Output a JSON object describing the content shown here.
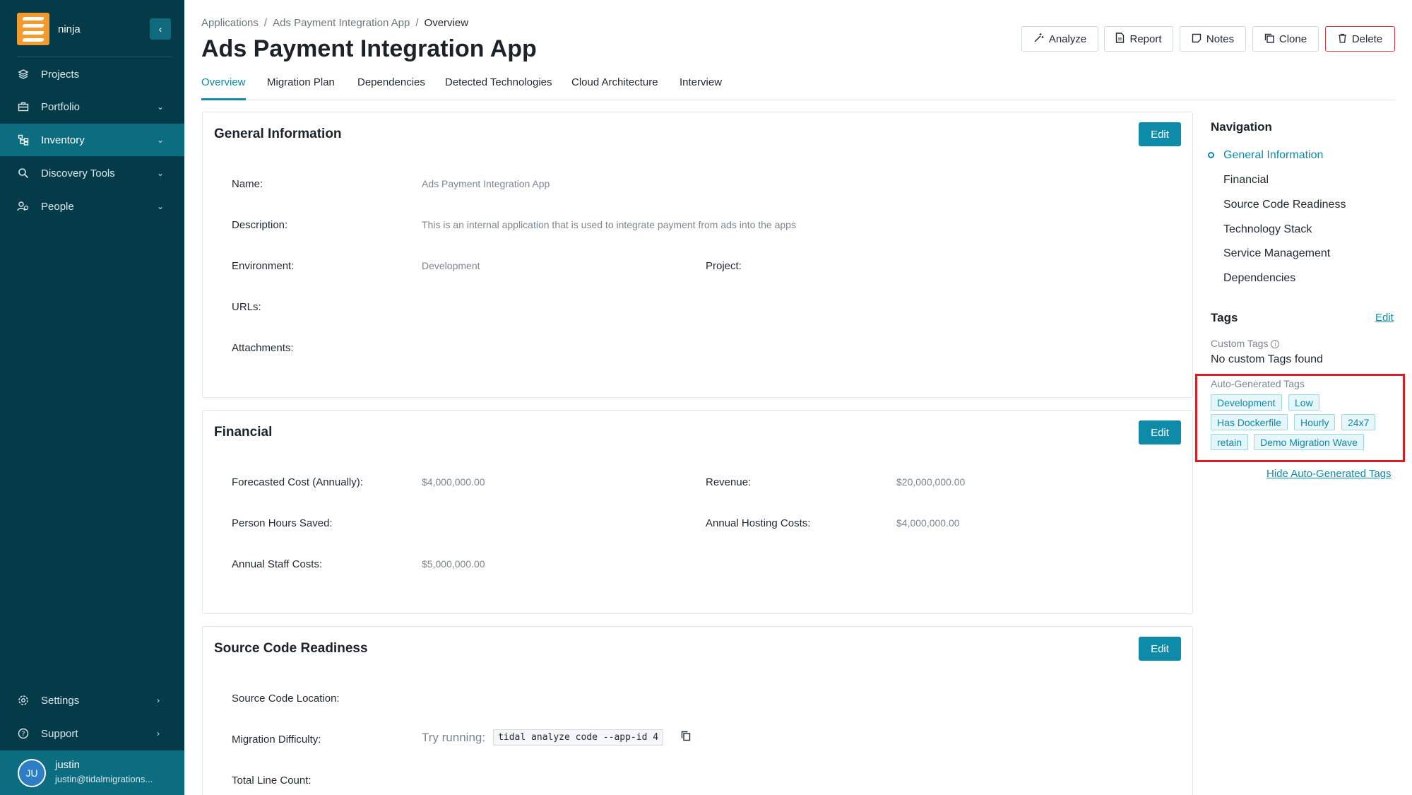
{
  "sidebar": {
    "org": "ninja",
    "items": [
      {
        "label": "Projects",
        "icon": "layers-icon"
      },
      {
        "label": "Portfolio",
        "icon": "briefcase-icon"
      },
      {
        "label": "Inventory",
        "icon": "hierarchy-icon"
      },
      {
        "label": "Discovery Tools",
        "icon": "search-icon"
      },
      {
        "label": "People",
        "icon": "people-icon"
      }
    ],
    "bottom": [
      {
        "label": "Settings",
        "icon": "gear-icon"
      },
      {
        "label": "Support",
        "icon": "help-icon"
      }
    ],
    "user": {
      "initials": "JU",
      "name": "justin",
      "email": "justin@tidalmigrations..."
    }
  },
  "breadcrumb": [
    "Applications",
    "Ads Payment Integration App",
    "Overview"
  ],
  "title": "Ads Payment Integration App",
  "actions": {
    "analyze": "Analyze",
    "report": "Report",
    "notes": "Notes",
    "clone": "Clone",
    "delete": "Delete"
  },
  "tabs": [
    "Overview",
    "Migration Plan",
    "Dependencies",
    "Detected Technologies",
    "Cloud Architecture",
    "Interview"
  ],
  "general": {
    "title": "General Information",
    "edit": "Edit",
    "name_label": "Name:",
    "name": "Ads Payment Integration App",
    "description_label": "Description:",
    "description": "This is an internal application that is used to integrate payment from ads into the apps",
    "environment_label": "Environment:",
    "environment": "Development",
    "project_label": "Project:",
    "urls_label": "URLs:",
    "attachments_label": "Attachments:"
  },
  "financial": {
    "title": "Financial",
    "edit": "Edit",
    "forecasted_label": "Forecasted Cost (Annually):",
    "forecasted": "$4,000,000.00",
    "revenue_label": "Revenue:",
    "revenue": "$20,000,000.00",
    "hours_label": "Person Hours Saved:",
    "hosting_label": "Annual Hosting Costs:",
    "hosting": "$4,000,000.00",
    "staff_label": "Annual Staff Costs:",
    "staff": "$5,000,000.00"
  },
  "source": {
    "title": "Source Code Readiness",
    "edit": "Edit",
    "location_label": "Source Code Location:",
    "difficulty_label": "Migration Difficulty:",
    "try_running": "Try running:",
    "command": "tidal analyze code --app-id 4",
    "line_count_label": "Total Line Count:"
  },
  "navigation": {
    "title": "Navigation",
    "links": [
      "General Information",
      "Financial",
      "Source Code Readiness",
      "Technology Stack",
      "Service Management",
      "Dependencies"
    ]
  },
  "tags": {
    "title": "Tags",
    "edit": "Edit",
    "custom_label": "Custom Tags",
    "no_custom": "No custom Tags found",
    "auto_label": "Auto-Generated Tags",
    "auto": [
      "Development",
      "Low",
      "Has Dockerfile",
      "Hourly",
      "24x7",
      "retain",
      "Demo Migration Wave"
    ],
    "hide": "Hide Auto-Generated Tags"
  },
  "colors": {
    "sidebar": "#053b48",
    "active": "#0c6c80",
    "accent": "#0e8ba8",
    "highlight": "#d81f26"
  }
}
